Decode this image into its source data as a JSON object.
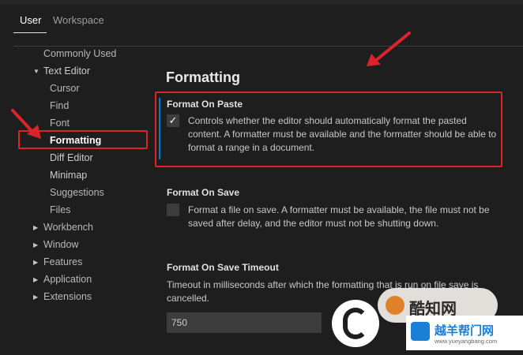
{
  "tabs": [
    "User",
    "Workspace"
  ],
  "toc": {
    "items": [
      {
        "label": "Commonly Used"
      },
      {
        "label": "Text Editor"
      },
      {
        "label": "Cursor"
      },
      {
        "label": "Find"
      },
      {
        "label": "Font"
      },
      {
        "label": "Formatting"
      },
      {
        "label": "Diff Editor"
      },
      {
        "label": "Minimap"
      },
      {
        "label": "Suggestions"
      },
      {
        "label": "Files"
      },
      {
        "label": "Workbench"
      },
      {
        "label": "Window"
      },
      {
        "label": "Features"
      },
      {
        "label": "Application"
      },
      {
        "label": "Extensions"
      }
    ]
  },
  "main": {
    "section_title": "Formatting",
    "format_on_paste": {
      "title": "Format On Paste",
      "checked": true,
      "description": "Controls whether the editor should automatically format the pasted content. A formatter must be available and the formatter should be able to format a range in a document."
    },
    "format_on_save": {
      "title": "Format On Save",
      "checked": false,
      "description": "Format a file on save. A formatter must be available, the file must not be saved after delay, and the editor must not be shutting down."
    },
    "format_on_save_timeout": {
      "title": "Format On Save Timeout",
      "description": "Timeout in milliseconds after which the formatting that is run on file save is cancelled.",
      "value": "750"
    }
  },
  "watermarks": {
    "cool_logo_text": "酷知网",
    "site_name": "越羊帮门网",
    "site_url": "www.yueyangbang.com"
  },
  "colors": {
    "background": "#1e1e1e",
    "highlight_red": "#d9252a",
    "focus_blue": "#007acc"
  }
}
